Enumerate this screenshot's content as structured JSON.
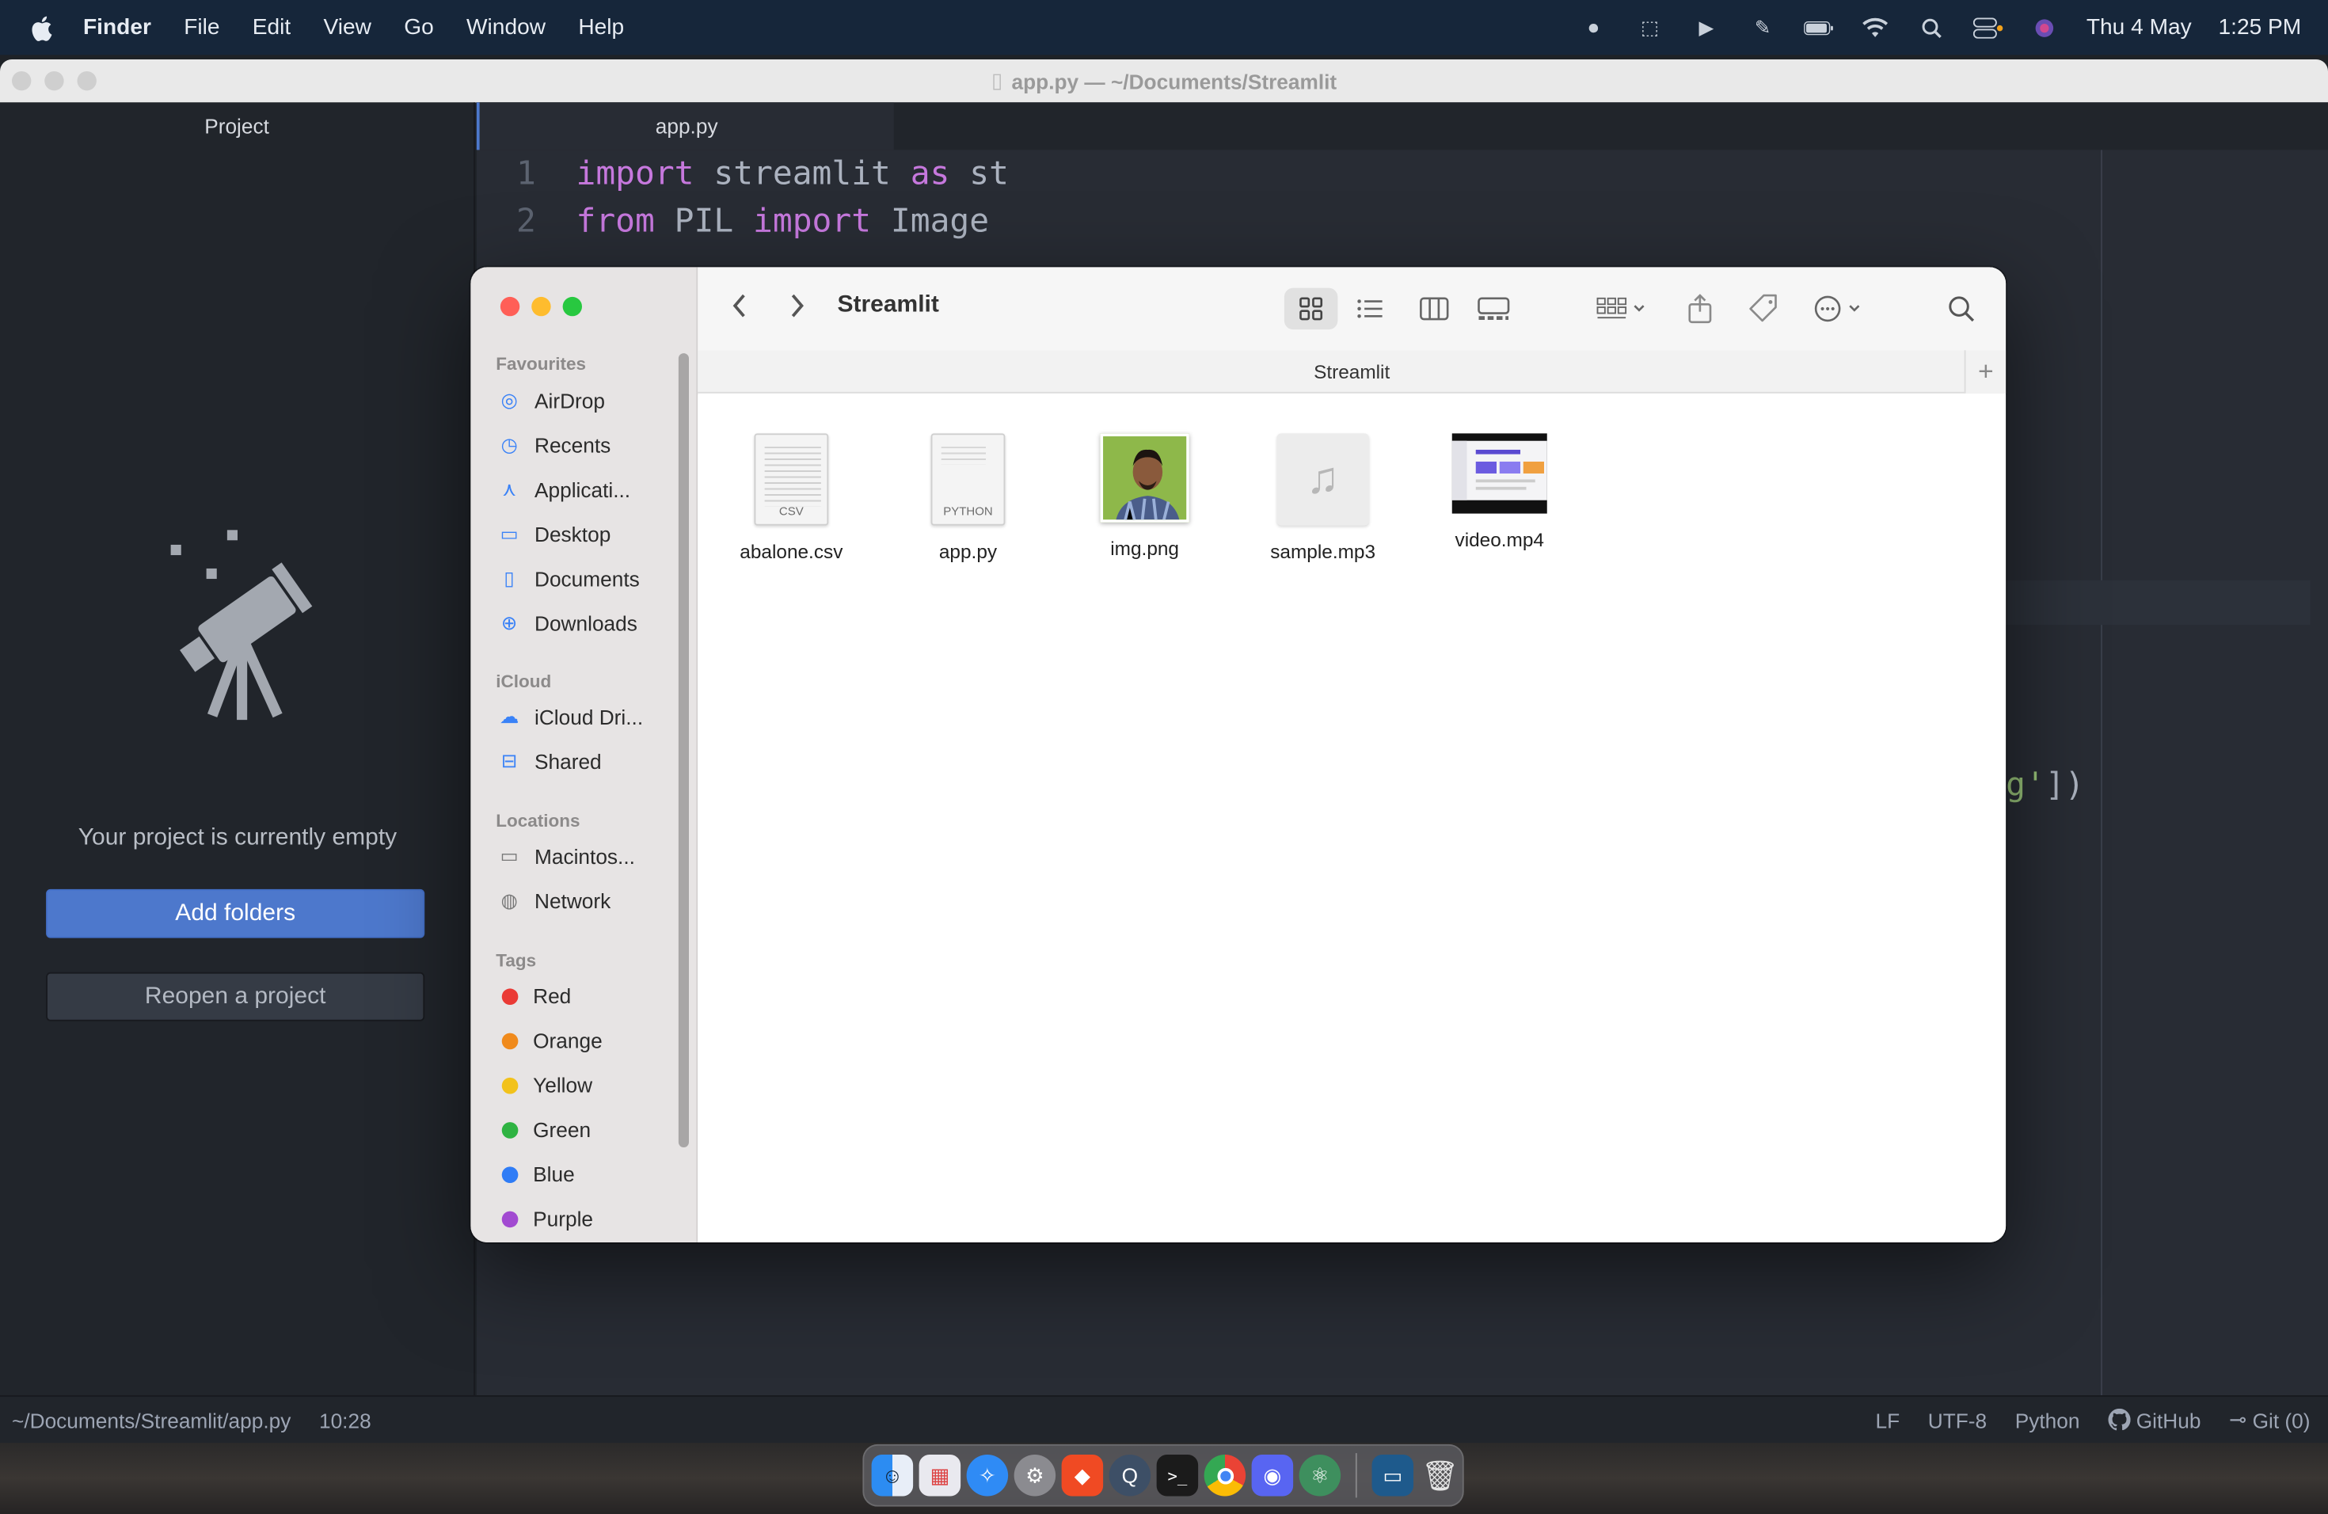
{
  "menubar": {
    "app": "Finder",
    "items": [
      "File",
      "Edit",
      "View",
      "Go",
      "Window",
      "Help"
    ],
    "date": "Thu 4 May",
    "time": "1:25 PM"
  },
  "atom": {
    "window_title": "app.py — ~/Documents/Streamlit",
    "project_title": "Project",
    "empty_message": "Your project is currently empty",
    "add_folders": "Add folders",
    "reopen_project": "Reopen a project",
    "tab": "app.py",
    "code": [
      {
        "num": "1",
        "a": "import",
        "b": " streamlit ",
        "c": "as",
        "d": " st"
      },
      {
        "num": "2",
        "a": "from",
        "b": " PIL ",
        "c": "import",
        "d": " Image"
      }
    ],
    "code_fragment_str": "g'",
    "code_fragment_rest": "])"
  },
  "status": {
    "path": "~/Documents/Streamlit/app.py",
    "cursor": "10:28",
    "line_ending": "LF",
    "encoding": "UTF-8",
    "grammar": "Python",
    "github": "GitHub",
    "git": "Git (0)"
  },
  "finder": {
    "title": "Streamlit",
    "path_bar": "Streamlit",
    "sections": {
      "favourites": "Favourites",
      "icloud": "iCloud",
      "locations": "Locations",
      "tags": "Tags"
    },
    "favourites": [
      "AirDrop",
      "Recents",
      "Applicati...",
      "Desktop",
      "Documents",
      "Downloads"
    ],
    "icloud": [
      "iCloud Dri...",
      "Shared"
    ],
    "locations": [
      "Macintos...",
      "Network"
    ],
    "tags": [
      {
        "name": "Red",
        "color": "#ea3a35"
      },
      {
        "name": "Orange",
        "color": "#f08a1c"
      },
      {
        "name": "Yellow",
        "color": "#f2c21b"
      },
      {
        "name": "Green",
        "color": "#2fb342"
      },
      {
        "name": "Blue",
        "color": "#2f7cf6"
      },
      {
        "name": "Purple",
        "color": "#a24ad1"
      }
    ],
    "files": [
      {
        "name": "abalone.csv",
        "kind": "csv",
        "label": "CSV"
      },
      {
        "name": "app.py",
        "kind": "python",
        "label": "PYTHON"
      },
      {
        "name": "img.png",
        "kind": "image"
      },
      {
        "name": "sample.mp3",
        "kind": "audio"
      },
      {
        "name": "video.mp4",
        "kind": "video"
      }
    ]
  },
  "colors": {
    "accent": "#4d78cc",
    "menubar_bg": "#16263a",
    "editor_bg": "#282c34"
  }
}
